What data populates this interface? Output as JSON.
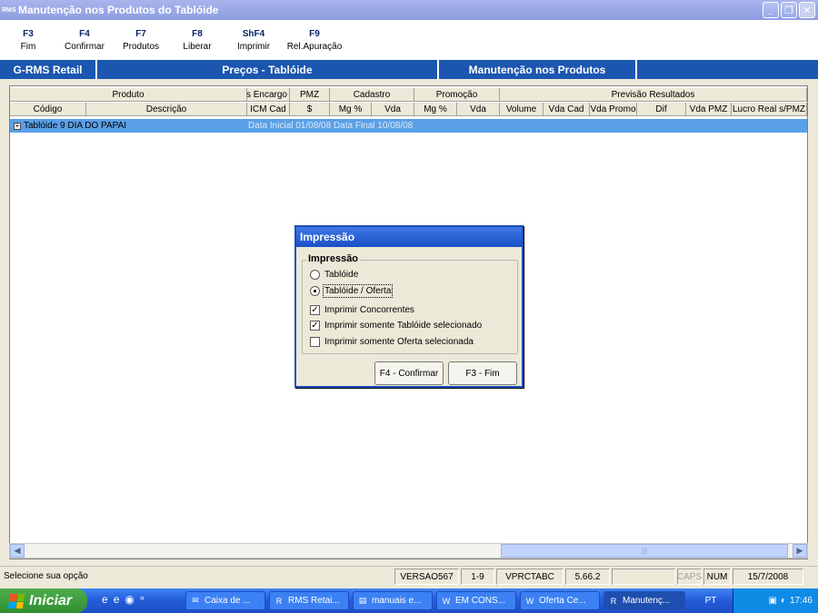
{
  "window": {
    "app_icon": "RMS",
    "title": "Manutenção nos Produtos do Tablóide",
    "controls": [
      "minimize-icon",
      "maximize-icon",
      "close-icon"
    ]
  },
  "toolbar": [
    {
      "key": "F3",
      "label": "Fim"
    },
    {
      "key": "F4",
      "label": "Confirmar"
    },
    {
      "key": "F7",
      "label": "Produtos"
    },
    {
      "key": "F8",
      "label": "Liberar"
    },
    {
      "key": "ShF4",
      "label": "Imprimir"
    },
    {
      "key": "F9",
      "label": "Rel.Apuração"
    }
  ],
  "band": {
    "left": "G-RMS Retail",
    "middle": "Preços - Tablóide",
    "right": "Manutenção nos Produtos"
  },
  "grid": {
    "group_headers": [
      "Produto",
      "s Encargo",
      "PMZ",
      "Cadastro",
      "Promoção",
      "Previsão Resultados"
    ],
    "columns": [
      "Código",
      "Descrição",
      "ICM Cad",
      "$",
      "Mg %",
      "Vda",
      "Mg %",
      "Vda",
      "Volume",
      "Vda Cad",
      "Vda Promo",
      "Dif",
      "Vda PMZ",
      "Lucro Real s/PMZ"
    ],
    "rows": [
      {
        "label": "Tablóide 9 DIA DO PAPAI",
        "dates": "Data Inicial 01/08/08  Data Final 10/08/08"
      }
    ]
  },
  "dialog": {
    "title": "Impressão",
    "group_title": "Impressão",
    "radios": [
      {
        "label": "Tablóide",
        "checked": false
      },
      {
        "label": "Tablóide / Oferta",
        "checked": true
      }
    ],
    "checks": [
      {
        "label": "Imprimir Concorrentes",
        "checked": true
      },
      {
        "label": "Imprimir somente Tablóide selecionado",
        "checked": true
      },
      {
        "label": "Imprimir somente Oferta selecionada",
        "checked": false
      }
    ],
    "confirm_label": "F4 - Confirmar",
    "cancel_label": "F3 - Fim"
  },
  "status": {
    "message": "Selecione sua opção",
    "version": "VERSAO567",
    "page": "1-9",
    "program": "VPRCTABC",
    "build": "5.66.2",
    "caps": "CAPS",
    "num": "NUM",
    "date": "15/7/2008"
  },
  "taskbar": {
    "start_label": "Iniciar",
    "tasks": [
      {
        "label": "Caixa de ...",
        "icon": "mail-icon",
        "active": false
      },
      {
        "label": "RMS Retai...",
        "icon": "rms-icon",
        "active": false
      },
      {
        "label": "manuais e...",
        "icon": "folder-icon",
        "active": false
      },
      {
        "label": "EM CONS...",
        "icon": "word-icon",
        "active": false
      },
      {
        "label": "Oferta Ce...",
        "icon": "word-icon",
        "active": false
      },
      {
        "label": "Manutenç...",
        "icon": "rms-icon",
        "active": true
      }
    ],
    "language": "PT",
    "clock": "17:46"
  }
}
